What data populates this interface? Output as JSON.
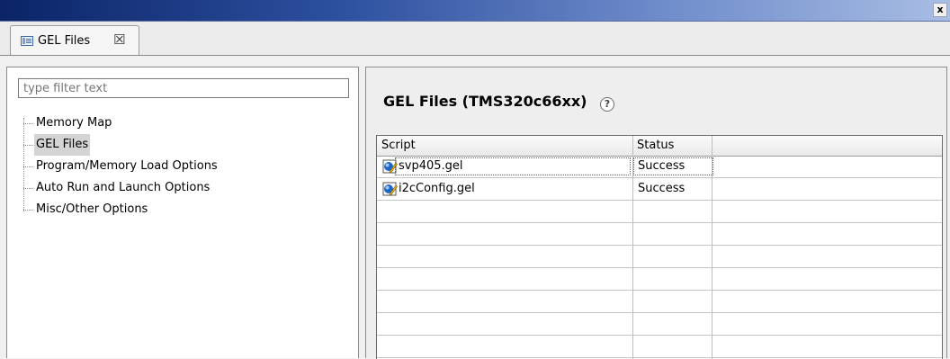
{
  "window": {
    "close_glyph": "x"
  },
  "tab": {
    "label": "GEL Files",
    "close_glyph": "☒",
    "icon": "view-icon"
  },
  "left": {
    "filter_placeholder": "type filter text",
    "items": [
      {
        "label": "Memory Map",
        "selected": false
      },
      {
        "label": "GEL Files",
        "selected": true
      },
      {
        "label": "Program/Memory Load Options",
        "selected": false
      },
      {
        "label": "Auto Run and Launch Options",
        "selected": false
      },
      {
        "label": "Misc/Other Options",
        "selected": false
      }
    ]
  },
  "right": {
    "title": "GEL Files (TMS320c66xx)",
    "help_glyph": "?",
    "table": {
      "columns": [
        "Script",
        "Status",
        ""
      ],
      "rows": [
        {
          "script": "svp405.gel",
          "status": "Success",
          "icon": "gel-script-icon"
        },
        {
          "script": "i2cConfig.gel",
          "status": "Success",
          "icon": "gel-script-icon"
        }
      ],
      "empty_rows": 7
    }
  },
  "colors": {
    "title_bar_start": "#0b2467",
    "selection": "#d4d4d4",
    "icon_blue": "#1f66c6",
    "icon_yellow": "#e0b020"
  }
}
